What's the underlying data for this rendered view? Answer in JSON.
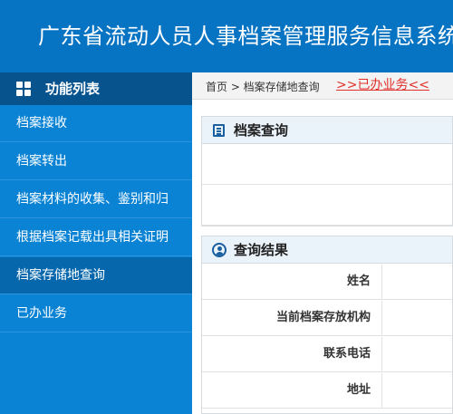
{
  "header": {
    "title": "广东省流动人员人事档案管理服务信息系统"
  },
  "sidebar": {
    "heading": "功能列表",
    "items": [
      {
        "label": "档案接收"
      },
      {
        "label": "档案转出"
      },
      {
        "label": "档案材料的收集、鉴别和归"
      },
      {
        "label": "根据档案记载出具相关证明"
      },
      {
        "label": "档案存储地查询"
      },
      {
        "label": "已办业务"
      }
    ],
    "active_index": 4
  },
  "breadcrumb": {
    "text": "首页 > 档案存储地查询",
    "link": ">>已办业务<<"
  },
  "query_panel": {
    "title": "档案查询"
  },
  "result_panel": {
    "title": "查询结果",
    "rows": [
      {
        "label": "姓名",
        "value": ""
      },
      {
        "label": "当前档案存放机构",
        "value": ""
      },
      {
        "label": "联系电话",
        "value": ""
      },
      {
        "label": "地址",
        "value": ""
      }
    ]
  },
  "colors": {
    "header_bg": "#0673c3",
    "sidebar_bg": "#0a83d4",
    "sidebar_head_bg": "#06538e",
    "active_item_bg": "#0667ad",
    "link_red": "#e0302a"
  }
}
